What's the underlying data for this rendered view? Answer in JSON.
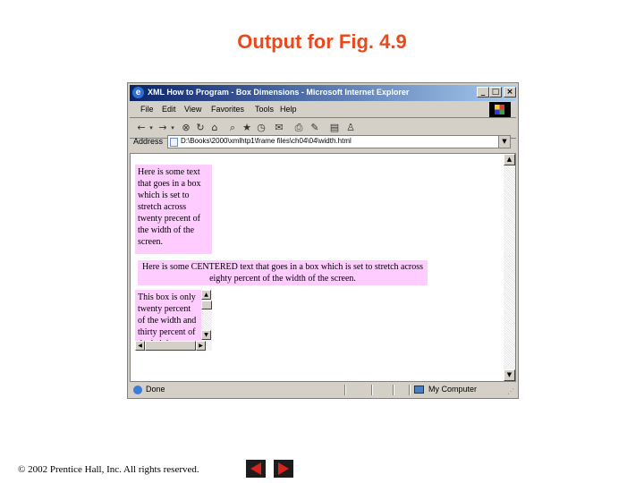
{
  "slide": {
    "title": "Output for Fig. 4.9",
    "copyright_symbol": "©",
    "copyright": "2002 Prentice Hall, Inc.  All rights reserved.",
    "nav_icons": [
      "previous-slide-icon",
      "next-slide-icon"
    ],
    "title_color": "#e8491d"
  },
  "browser": {
    "title": "XML How to Program - Box Dimensions - Microsoft Internet Explorer",
    "window_buttons": [
      "_",
      "□",
      "×"
    ],
    "menu": [
      "File",
      "Edit",
      "View",
      "Favorites",
      "Tools",
      "Help"
    ],
    "toolbar_icons": [
      "back-icon",
      "back-dropdown-icon",
      "forward-icon",
      "forward-dropdown-icon",
      "stop-icon",
      "refresh-icon",
      "home-icon",
      "search-icon",
      "favorites-icon",
      "history-icon",
      "mail-icon",
      "print-icon",
      "edit-icon",
      "discuss-icon",
      "messenger-icon"
    ],
    "address_label": "Address",
    "address_value": "D:\\Books\\2000\\xmlhtp1\\frame files\\ch04\\04\\width.html",
    "status": "Done",
    "zone": "My Computer"
  },
  "content": {
    "box1": "Here is some text that goes in a box which is set to stretch across twenty precent of the width of the screen.",
    "box2": "Here is some CENTERED text that goes in a box which is set to stretch across eighty percent of the width of the screen.",
    "box3": "This box is only twenty percent of the width and thirty percent of the height. What do we do if it overflows? Set the overflow property to scroll!",
    "box_color": "#ffccff"
  }
}
